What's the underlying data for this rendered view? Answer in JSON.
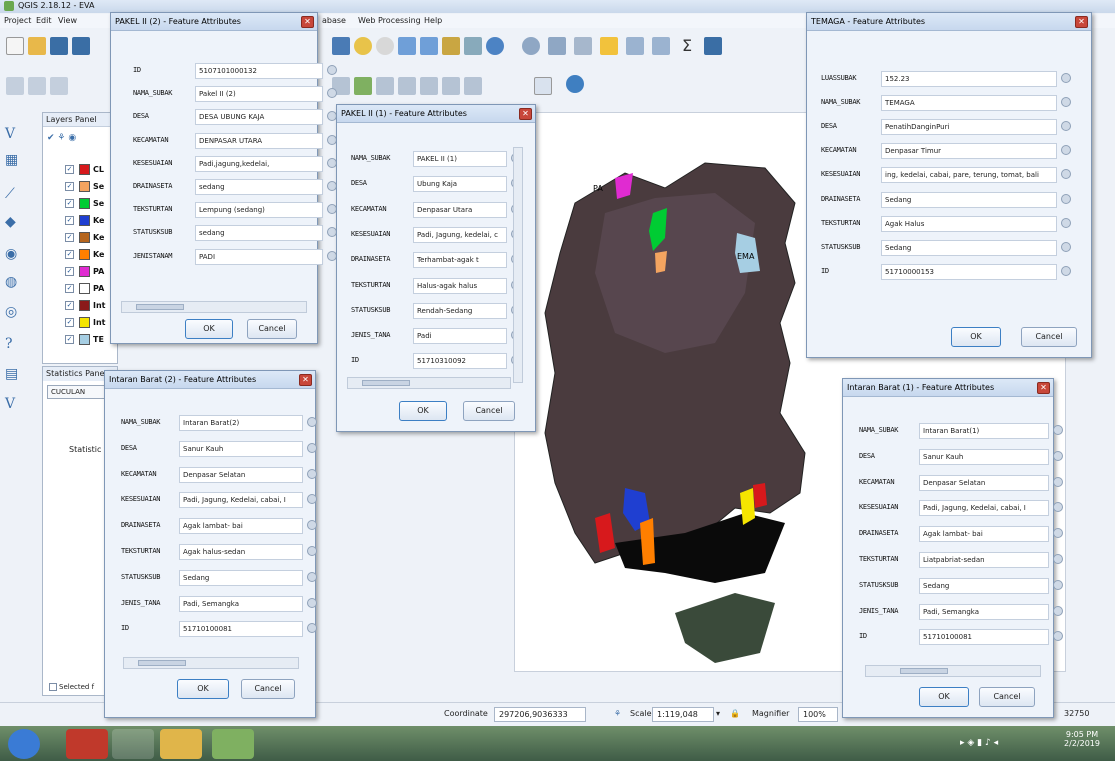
{
  "window": {
    "title": "QGIS 2.18.12 - EVA"
  },
  "menubar": [
    "Project",
    "Edit",
    "View",
    "abase",
    "Web",
    "Processing",
    "Help"
  ],
  "layers_panel": {
    "title": "Layers Panel",
    "layers": [
      {
        "name": "CL",
        "color": "#d7191c"
      },
      {
        "name": "Se",
        "color": "#f4a460"
      },
      {
        "name": "Se",
        "color": "#00cc33"
      },
      {
        "name": "Ke",
        "color": "#1f3fd1"
      },
      {
        "name": "Ke",
        "color": "#b5651d"
      },
      {
        "name": "Ke",
        "color": "#ff7f00"
      },
      {
        "name": "PA",
        "color": "#e02bd1"
      },
      {
        "name": "PA",
        "color": "#ffffff"
      },
      {
        "name": "Int",
        "color": "#8b1a1a"
      },
      {
        "name": "Int",
        "color": "#f5e500"
      },
      {
        "name": "TE",
        "color": "#a6cee3"
      }
    ]
  },
  "stats_panel": {
    "title": "Statistics Panel",
    "select": "CUCULAN",
    "header": "Statistic",
    "checkbox": "Selected f"
  },
  "statusbar": {
    "coordinate_label": "Coordinate",
    "coordinate_value": "297206,9036333",
    "scale_label": "Scale",
    "scale_value": "1:119,048",
    "magnifier_label": "Magnifier",
    "magnifier_value": "100%",
    "rotation_value": "32750"
  },
  "clock": {
    "time": "9:05 PM",
    "date": "2/2/2019"
  },
  "map_labels": [
    "PA",
    "EMA"
  ],
  "dialogs": {
    "pakel2_2": {
      "title": "PAKEL II (2) - Feature Attributes",
      "fields": [
        {
          "label": "ID",
          "value": "5107101000132"
        },
        {
          "label": "NAMA_SUBAK",
          "value": "Pakel II (2)"
        },
        {
          "label": "DESA",
          "value": "DESA UBUNG KAJA"
        },
        {
          "label": "KECAMATAN",
          "value": "DENPASAR UTARA"
        },
        {
          "label": "KESESUAIAN",
          "value": "Padi,jagung,kedelai,"
        },
        {
          "label": "DRAINASETA",
          "value": "sedang"
        },
        {
          "label": "TEKSTURTAN",
          "value": "Lempung (sedang)"
        },
        {
          "label": "STATUSKSUB",
          "value": "sedang"
        },
        {
          "label": "JENISTANAM",
          "value": "PADI"
        }
      ],
      "ok": "OK",
      "cancel": "Cancel"
    },
    "pakel2_1": {
      "title": "PAKEL II (1) - Feature Attributes",
      "fields": [
        {
          "label": "NAMA_SUBAK",
          "value": "PAKEL II (1)"
        },
        {
          "label": "DESA",
          "value": "Ubung Kaja"
        },
        {
          "label": "KECAMATAN",
          "value": "Denpasar Utara"
        },
        {
          "label": "KESESUAIAN",
          "value": "Padi, Jagung, kedelai, c"
        },
        {
          "label": "DRAINASETA",
          "value": "Terhambat-agak t"
        },
        {
          "label": "TEKSTURTAN",
          "value": "Halus-agak halus"
        },
        {
          "label": "STATUSKSUB",
          "value": "Rendah-Sedang"
        },
        {
          "label": "JENIS_TANA",
          "value": "Padi"
        },
        {
          "label": "ID",
          "value": "51710310092"
        }
      ],
      "ok": "OK",
      "cancel": "Cancel"
    },
    "temaga": {
      "title": "TEMAGA - Feature Attributes",
      "fields": [
        {
          "label": "LUASSUBAK",
          "value": "152.23"
        },
        {
          "label": "NAMA_SUBAK",
          "value": "TEMAGA"
        },
        {
          "label": "DESA",
          "value": "PenatihDanginPuri"
        },
        {
          "label": "KECAMATAN",
          "value": "Denpasar Timur"
        },
        {
          "label": "KESESUAIAN",
          "value": "ing, kedelai, cabai, pare, terung, tomat, bali"
        },
        {
          "label": "DRAINASETA",
          "value": "Sedang"
        },
        {
          "label": "TEKSTURTAN",
          "value": "Agak Halus"
        },
        {
          "label": "STATUSKSUB",
          "value": "Sedang"
        },
        {
          "label": "ID",
          "value": "51710000153"
        }
      ],
      "ok": "OK",
      "cancel": "Cancel"
    },
    "intaran2": {
      "title": "Intaran Barat (2) - Feature Attributes",
      "fields": [
        {
          "label": "NAMA_SUBAK",
          "value": "Intaran Barat(2)"
        },
        {
          "label": "DESA",
          "value": "Sanur Kauh"
        },
        {
          "label": "KECAMATAN",
          "value": "Denpasar Selatan"
        },
        {
          "label": "KESESUAIAN",
          "value": "Padi, Jagung, Kedelai, cabai, I"
        },
        {
          "label": "DRAINASETA",
          "value": "Agak lambat- bai"
        },
        {
          "label": "TEKSTURTAN",
          "value": "Agak halus-sedan"
        },
        {
          "label": "STATUSKSUB",
          "value": "Sedang"
        },
        {
          "label": "JENIS_TANA",
          "value": "Padi, Semangka"
        },
        {
          "label": "ID",
          "value": "51710100081"
        }
      ],
      "ok": "OK",
      "cancel": "Cancel"
    },
    "intaran1": {
      "title": "Intaran Barat (1) - Feature Attributes",
      "fields": [
        {
          "label": "NAMA_SUBAK",
          "value": "Intaran Barat(1)"
        },
        {
          "label": "DESA",
          "value": "Sanur Kauh"
        },
        {
          "label": "KECAMATAN",
          "value": "Denpasar Selatan"
        },
        {
          "label": "KESESUAIAN",
          "value": "Padi, Jagung, Kedelai, cabai, I"
        },
        {
          "label": "DRAINASETA",
          "value": "Agak lambat- bai"
        },
        {
          "label": "TEKSTURTAN",
          "value": "Liatpabriat-sedan"
        },
        {
          "label": "STATUSKSUB",
          "value": "Sedang"
        },
        {
          "label": "JENIS_TANA",
          "value": "Padi, Semangka"
        },
        {
          "label": "ID",
          "value": "51710100081"
        }
      ],
      "ok": "OK",
      "cancel": "Cancel"
    }
  }
}
